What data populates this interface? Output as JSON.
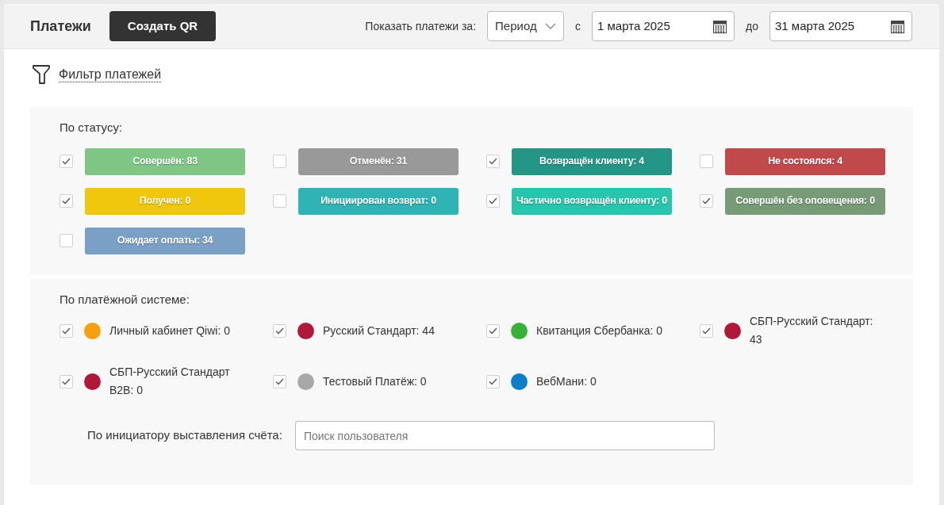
{
  "header": {
    "title": "Платежи",
    "create_button": "Создать QR",
    "period_label": "Показать платежи за:",
    "period_select": "Период",
    "from_label": "с",
    "from_date": "1 марта 2025",
    "to_label": "до",
    "to_date": "31 марта 2025"
  },
  "filter_link": "Фильтр платежей",
  "status_filter": {
    "title": "По статусу:",
    "items": [
      {
        "label": "Совершён: 83",
        "checked": true,
        "color": "#7fc685"
      },
      {
        "label": "Отменён: 31",
        "checked": false,
        "color": "#999999"
      },
      {
        "label": "Возвращён клиенту: 4",
        "checked": true,
        "color": "#239687"
      },
      {
        "label": "Не состоялся: 4",
        "checked": false,
        "color": "#c0494b"
      },
      {
        "label": "Получен: 0",
        "checked": true,
        "color": "#f0c70d"
      },
      {
        "label": "Инициирован возврат: 0",
        "checked": false,
        "color": "#2fb3b4"
      },
      {
        "label": "Частично возвращён клиенту: 0",
        "checked": true,
        "color": "#27c4ae"
      },
      {
        "label": "Совершён без оповещения: 0",
        "checked": true,
        "color": "#779a77"
      },
      {
        "label": "Ожидает оплаты: 34",
        "checked": false,
        "color": "#7aa0c5"
      }
    ]
  },
  "system_filter": {
    "title": "По платёжной системе:",
    "items": [
      {
        "label": "Личный кабинет Qiwi: 0",
        "checked": true,
        "color": "#f5a00f"
      },
      {
        "label": "Русский Стандарт: 44",
        "checked": true,
        "color": "#b0183a"
      },
      {
        "label": "Квитанция Сбербанка: 0",
        "checked": true,
        "color": "#36b336"
      },
      {
        "label": "СБП-Русский Стандарт: 43",
        "checked": true,
        "color": "#b0183a"
      },
      {
        "label": "СБП-Русский Стандарт B2B: 0",
        "checked": true,
        "color": "#b0183a"
      },
      {
        "label": "Тестовый Платёж: 0",
        "checked": true,
        "color": "#a8a8a8"
      },
      {
        "label": "ВебМани: 0",
        "checked": true,
        "color": "#0b7fc8"
      }
    ]
  },
  "initiator": {
    "label": "По инициатору выставления счёта:",
    "placeholder": "Поиск пользователя"
  }
}
